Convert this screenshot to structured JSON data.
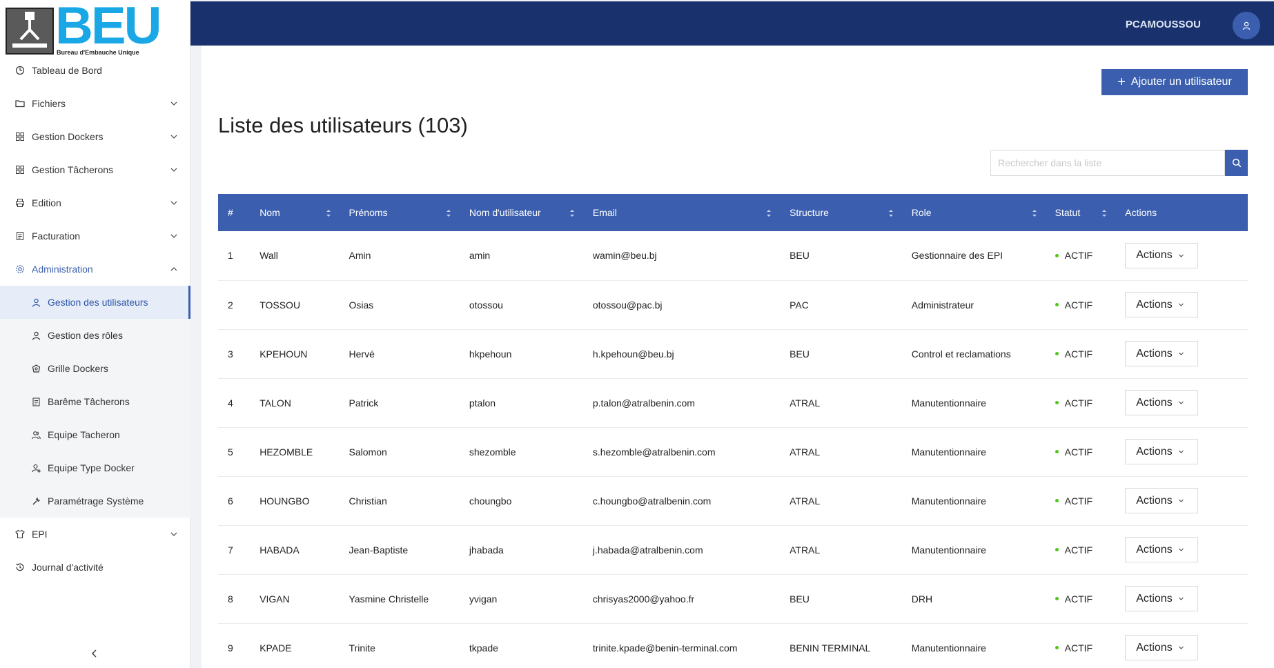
{
  "app": {
    "logo_text": "BEU",
    "logo_subtitle": "Bureau d'Embauche Unique",
    "user_name": "PCAMOUSSOU"
  },
  "sidebar": {
    "items": [
      {
        "label": "Tableau de Bord",
        "icon": "dashboard-icon"
      },
      {
        "label": "Fichiers",
        "icon": "folder-icon",
        "expandable": true
      },
      {
        "label": "Gestion Dockers",
        "icon": "grid-icon",
        "expandable": true
      },
      {
        "label": "Gestion Tâcherons",
        "icon": "grid-icon",
        "expandable": true
      },
      {
        "label": "Edition",
        "icon": "printer-icon",
        "expandable": true
      },
      {
        "label": "Facturation",
        "icon": "file-icon",
        "expandable": true
      },
      {
        "label": "Administration",
        "icon": "gear-icon",
        "expanded": true
      }
    ],
    "sub_items": [
      {
        "label": "Gestion des utilisateurs",
        "icon": "user-icon",
        "selected": true
      },
      {
        "label": "Gestion des rôles",
        "icon": "user-icon"
      },
      {
        "label": "Grille Dockers",
        "icon": "shield-icon"
      },
      {
        "label": "Barême Tâcherons",
        "icon": "file-icon"
      },
      {
        "label": "Equipe Tacheron",
        "icon": "team-icon"
      },
      {
        "label": "Equipe Type Docker",
        "icon": "user-settings-icon"
      },
      {
        "label": "Paramétrage Système",
        "icon": "tool-icon"
      }
    ],
    "bottom_items": [
      {
        "label": "EPI",
        "icon": "shirt-icon",
        "expandable": true
      },
      {
        "label": "Journal d'activité",
        "icon": "history-icon"
      }
    ]
  },
  "main": {
    "add_button_label": "Ajouter un utilisateur",
    "title": "Liste des utilisateurs (103)",
    "search_placeholder": "Rechercher dans la liste",
    "columns": [
      "#",
      "Nom",
      "Prénoms",
      "Nom d'utilisateur",
      "Email",
      "Structure",
      "Role",
      "Statut",
      "Actions"
    ],
    "rows": [
      {
        "num": "1",
        "nom": "Wall",
        "prenoms": "Amin",
        "username": "amin",
        "email": "wamin@beu.bj",
        "structure": "BEU",
        "role": "Gestionnaire des EPI",
        "statut": "ACTIF",
        "action": "Actions"
      },
      {
        "num": "2",
        "nom": "TOSSOU",
        "prenoms": "Osias",
        "username": "otossou",
        "email": "otossou@pac.bj",
        "structure": "PAC",
        "role": "Administrateur",
        "statut": "ACTIF",
        "action": "Actions"
      },
      {
        "num": "3",
        "nom": "KPEHOUN",
        "prenoms": "Hervé",
        "username": "hkpehoun",
        "email": "h.kpehoun@beu.bj",
        "structure": "BEU",
        "role": "Control et reclamations",
        "statut": "ACTIF",
        "action": "Actions"
      },
      {
        "num": "4",
        "nom": "TALON",
        "prenoms": "Patrick",
        "username": "ptalon",
        "email": "p.talon@atralbenin.com",
        "structure": "ATRAL",
        "role": "Manutentionnaire",
        "statut": "ACTIF",
        "action": "Actions"
      },
      {
        "num": "5",
        "nom": "HEZOMBLE",
        "prenoms": "Salomon",
        "username": "shezomble",
        "email": "s.hezomble@atralbenin.com",
        "structure": "ATRAL",
        "role": "Manutentionnaire",
        "statut": "ACTIF",
        "action": "Actions"
      },
      {
        "num": "6",
        "nom": "HOUNGBO",
        "prenoms": "Christian",
        "username": "choungbo",
        "email": "c.houngbo@atralbenin.com",
        "structure": "ATRAL",
        "role": "Manutentionnaire",
        "statut": "ACTIF",
        "action": "Actions"
      },
      {
        "num": "7",
        "nom": "HABADA",
        "prenoms": "Jean-Baptiste",
        "username": "jhabada",
        "email": "j.habada@atralbenin.com",
        "structure": "ATRAL",
        "role": "Manutentionnaire",
        "statut": "ACTIF",
        "action": "Actions"
      },
      {
        "num": "8",
        "nom": "VIGAN",
        "prenoms": "Yasmine Christelle",
        "username": "yvigan",
        "email": "chrisyas2000@yahoo.fr",
        "structure": "BEU",
        "role": "DRH",
        "statut": "ACTIF",
        "action": "Actions"
      },
      {
        "num": "9",
        "nom": "KPADE",
        "prenoms": "Trinite",
        "username": "tkpade",
        "email": "trinite.kpade@benin-terminal.com",
        "structure": "BENIN TERMINAL",
        "role": "Manutentionnaire",
        "statut": "ACTIF",
        "action": "Actions"
      }
    ]
  },
  "colors": {
    "header_bg": "#19326e",
    "accent": "#3b5fae",
    "logo_blue": "#1aa7e6",
    "status_active": "#52c41a"
  }
}
